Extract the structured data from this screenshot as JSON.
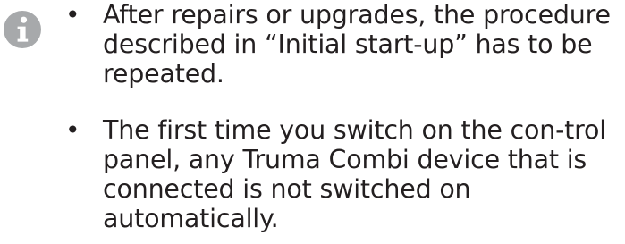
{
  "note": {
    "icon": "info-icon",
    "colors": {
      "icon": "#a7a9ab",
      "text": "#231f20"
    },
    "bullet_symbol": "•",
    "items": [
      "After repairs or upgrades, the procedure described in “Initial start-up” has to be repeated.",
      "The first time you switch on the con-trol panel, any Truma Combi device that is connected is not switched on automatically."
    ]
  }
}
